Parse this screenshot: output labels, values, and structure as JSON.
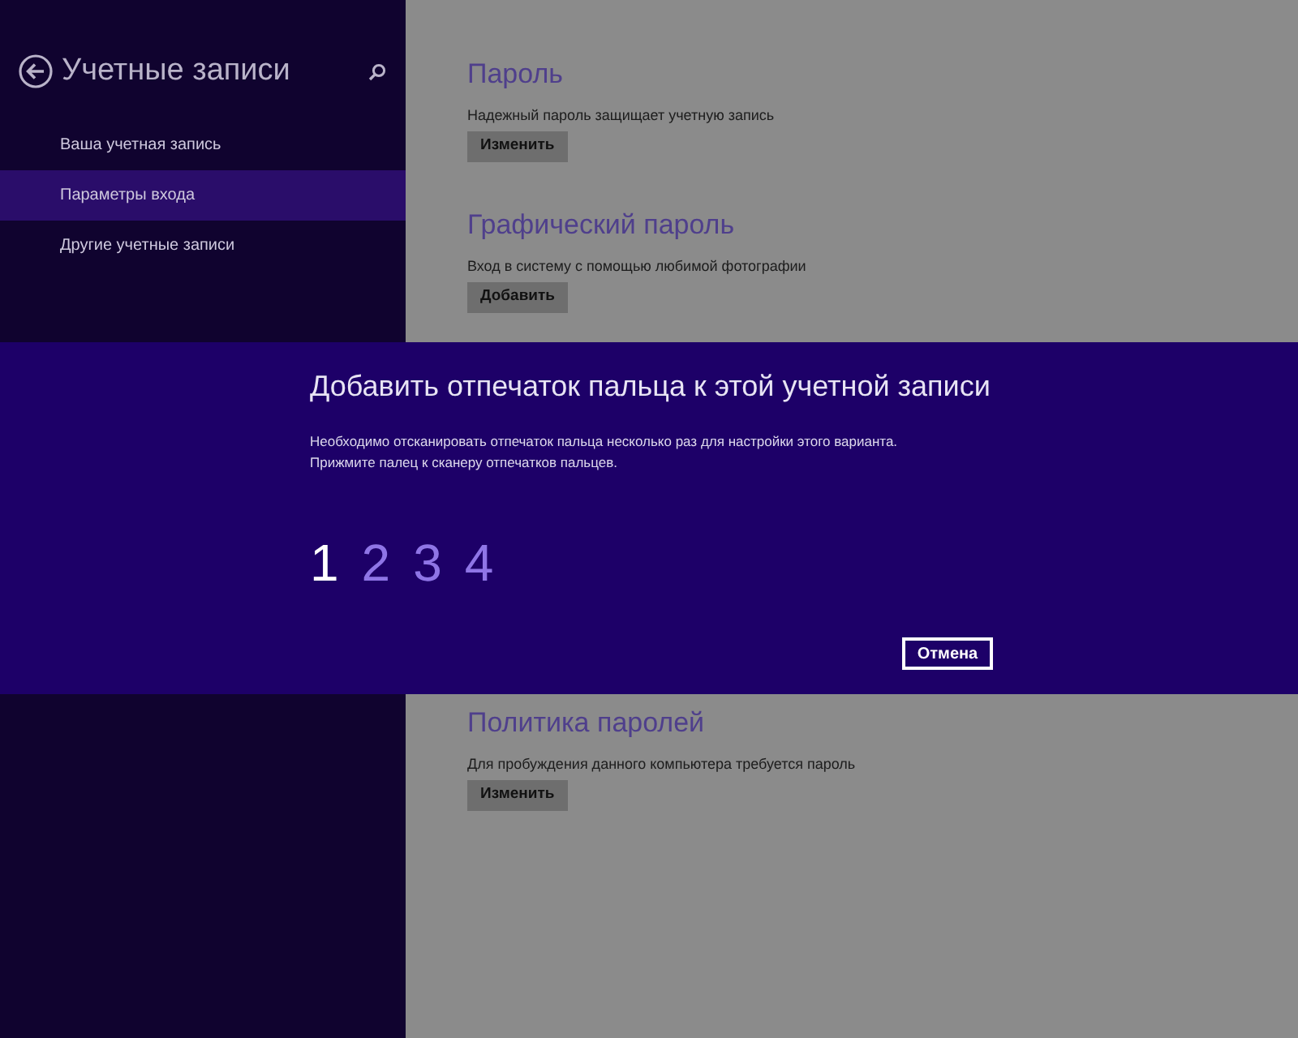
{
  "sidebar": {
    "title": "Учетные записи",
    "items": [
      {
        "label": "Ваша учетная запись",
        "selected": false
      },
      {
        "label": "Параметры входа",
        "selected": true
      },
      {
        "label": "Другие учетные записи",
        "selected": false
      }
    ]
  },
  "sections": [
    {
      "heading": "Пароль",
      "description": "Надежный пароль защищает учетную запись",
      "button": "Изменить"
    },
    {
      "heading": "Графический пароль",
      "description": "Вход в систему с помощью любимой фотографии",
      "button": "Добавить"
    },
    {
      "heading": "Политика паролей",
      "description": "Для пробуждения данного компьютера требуется пароль",
      "button": "Изменить"
    }
  ],
  "dialog": {
    "title": "Добавить отпечаток пальца к этой учетной записи",
    "lines": [
      "Необходимо отсканировать отпечаток пальца несколько раз для настройки этого варианта.",
      "Прижмите палец к сканеру отпечатков пальцев."
    ],
    "steps": [
      {
        "label": "1",
        "active": true
      },
      {
        "label": "2",
        "active": false
      },
      {
        "label": "3",
        "active": false
      },
      {
        "label": "4",
        "active": false
      }
    ],
    "cancel": "Отмена"
  }
}
